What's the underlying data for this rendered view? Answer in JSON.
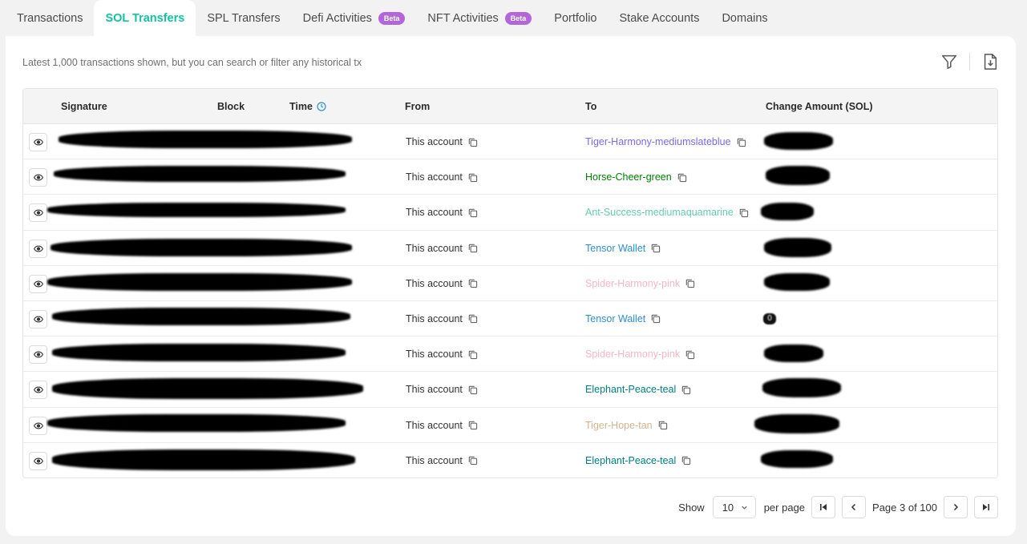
{
  "tabs": [
    {
      "label": "Transactions"
    },
    {
      "label": "SOL Transfers"
    },
    {
      "label": "SPL Transfers"
    },
    {
      "label": "Defi Activities",
      "badge": "Beta"
    },
    {
      "label": "NFT Activities",
      "badge": "Beta"
    },
    {
      "label": "Portfolio"
    },
    {
      "label": "Stake Accounts"
    },
    {
      "label": "Domains"
    }
  ],
  "active_tab": "SOL Transfers",
  "note": "Latest 1,000 transactions shown, but you can search or filter any historical tx",
  "table": {
    "columns": {
      "signature": "Signature",
      "block": "Block",
      "time": "Time",
      "from": "From",
      "to": "To",
      "change": "Change Amount (SOL)"
    },
    "rows": [
      {
        "from": "This account",
        "to": "Tiger-Harmony-mediumslateblue",
        "to_color": "#7b68ee"
      },
      {
        "from": "This account",
        "to": "Horse-Cheer-green",
        "to_color": "#008000"
      },
      {
        "from": "This account",
        "to": "Ant-Success-mediumaquamarine",
        "to_color": "#66cdaa"
      },
      {
        "from": "This account",
        "to": "Tensor Wallet",
        "to_color": "#2d8ed6"
      },
      {
        "from": "This account",
        "to": "Spider-Harmony-pink",
        "to_color": "#f4b6c6"
      },
      {
        "from": "This account",
        "to": "Tensor Wallet",
        "to_color": "#2d8ed6"
      },
      {
        "from": "This account",
        "to": "Spider-Harmony-pink",
        "to_color": "#f4b6c6"
      },
      {
        "from": "This account",
        "to": "Elephant-Peace-teal",
        "to_color": "#008080"
      },
      {
        "from": "This account",
        "to": "Tiger-Hope-tan",
        "to_color": "#d2b48c"
      },
      {
        "from": "This account",
        "to": "Elephant-Peace-teal",
        "to_color": "#008080"
      }
    ],
    "redacted_change_fragment": "0"
  },
  "pagination": {
    "show_label": "Show",
    "per_page_value": "10",
    "per_page_label": "per page",
    "page_text": "Page 3 of 100"
  },
  "colors": {
    "accent": "#14c2a0",
    "badge": "#b366d9"
  }
}
